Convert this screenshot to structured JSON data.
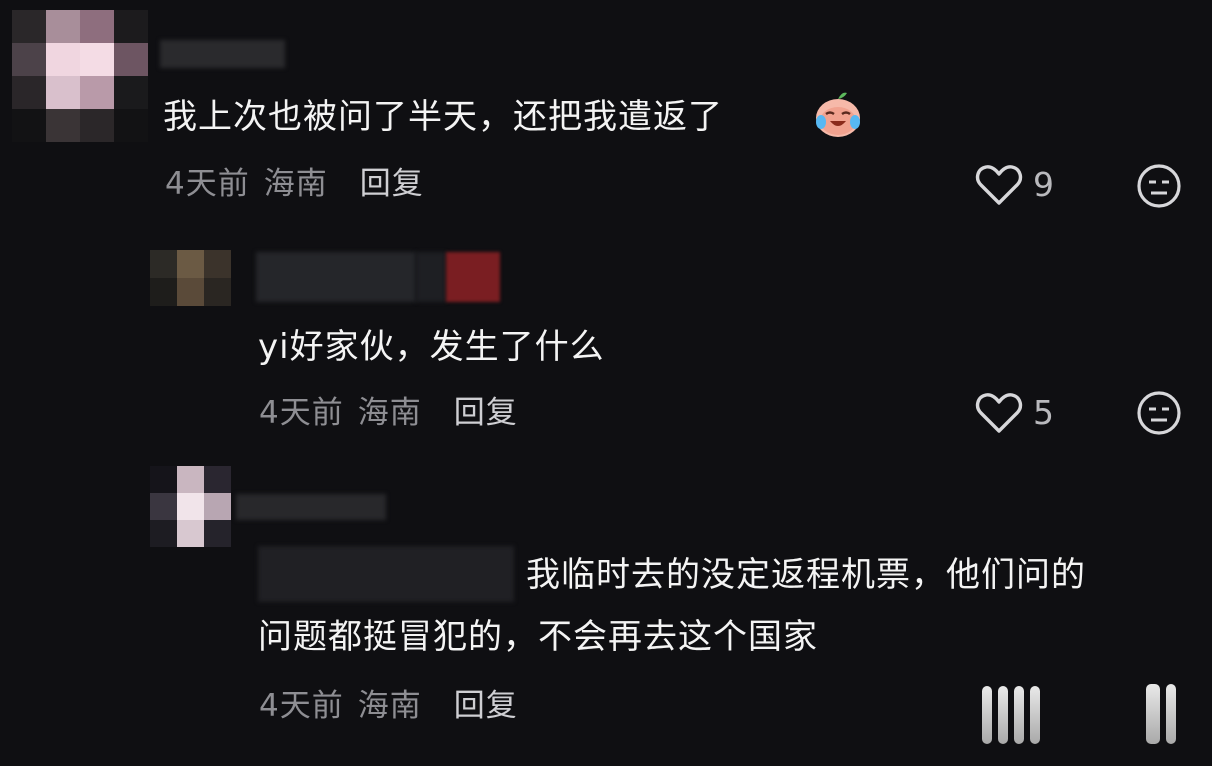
{
  "comments": [
    {
      "text": "我上次也被问了半天，还把我遣返了",
      "time": "4天前",
      "location": "海南",
      "reply_label": "回复",
      "likes": "9"
    },
    {
      "text": "yi好家伙，发生了什么",
      "time": "4天前",
      "location": "海南",
      "reply_label": "回复",
      "likes": "5"
    },
    {
      "text_line1": "我临时去的没定返程机票，他们问的",
      "text_line2": "问题都挺冒犯的，不会再去这个国家",
      "time": "4天前",
      "location": "海南",
      "reply_label": "回复"
    }
  ],
  "icons": {
    "like": "heart-outline-icon",
    "dislike": "unamused-face-icon",
    "emoji": "crying-laughing-emoji"
  },
  "colors": {
    "background": "#0f0f12",
    "text": "#f4f4f4",
    "meta": "#8e8e93"
  }
}
